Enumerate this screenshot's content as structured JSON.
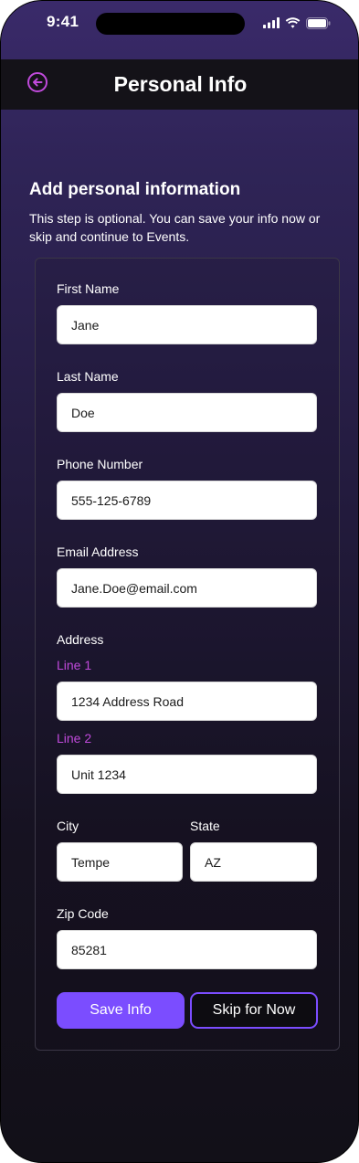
{
  "status_bar": {
    "time": "9:41",
    "icons": [
      "cellular-signal-icon",
      "wifi-icon",
      "battery-icon"
    ]
  },
  "header": {
    "title": "Personal Info",
    "back_icon": "back-arrow-circle-icon"
  },
  "intro": {
    "heading": "Add personal information",
    "description": "This step is optional. You can save your info now or skip and continue to Events."
  },
  "form": {
    "first_name": {
      "label": "First Name",
      "value": "Jane"
    },
    "last_name": {
      "label": "Last Name",
      "value": "Doe"
    },
    "phone": {
      "label": "Phone Number",
      "value": "555-125-6789"
    },
    "email": {
      "label": "Email Address",
      "value": "Jane.Doe@email.com"
    },
    "address": {
      "label": "Address",
      "line1": {
        "label": "Line 1",
        "value": "1234 Address Road"
      },
      "line2": {
        "label": "Line 2",
        "value": "Unit 1234"
      }
    },
    "city": {
      "label": "City",
      "value": "Tempe"
    },
    "state": {
      "label": "State",
      "value": "AZ"
    },
    "zip": {
      "label": "Zip Code",
      "value": "85281"
    }
  },
  "actions": {
    "save_label": "Save Info",
    "skip_label": "Skip for Now"
  },
  "colors": {
    "accent": "#7b4dff",
    "sub_label": "#c04adb",
    "back_icon": "#c04adb",
    "header_bg": "#141218"
  }
}
